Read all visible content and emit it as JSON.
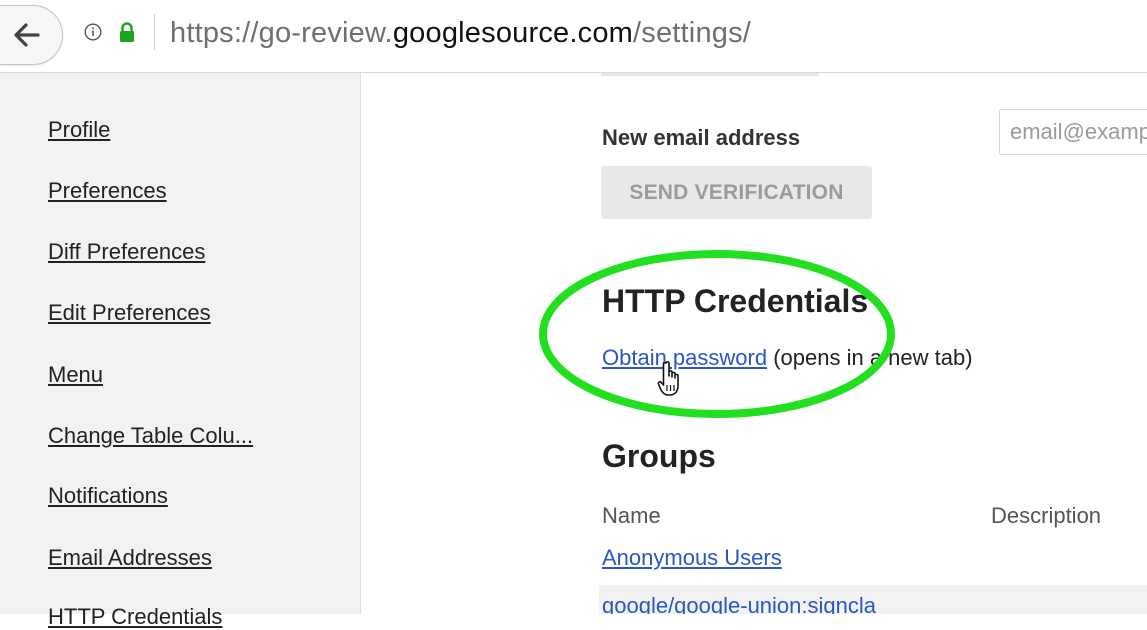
{
  "browser": {
    "url_prefix": "https://go-review.",
    "url_host": "googlesource.com",
    "url_suffix": "/settings/"
  },
  "sidebar": {
    "items": [
      {
        "label": "Profile"
      },
      {
        "label": "Preferences"
      },
      {
        "label": "Diff Preferences"
      },
      {
        "label": "Edit Preferences"
      },
      {
        "label": "Menu"
      },
      {
        "label": "Change Table Colu..."
      },
      {
        "label": "Notifications"
      },
      {
        "label": "Email Addresses"
      },
      {
        "label": "HTTP Credentials"
      }
    ]
  },
  "email": {
    "new_label": "New email address",
    "placeholder": "email@example.com",
    "send_button": "SEND VERIFICATION"
  },
  "http_credentials": {
    "heading": "HTTP Credentials",
    "link": "Obtain password",
    "note": " (opens in a new tab)"
  },
  "groups": {
    "heading": "Groups",
    "columns": [
      "Name",
      "Description"
    ],
    "rows": [
      {
        "name": "Anonymous Users"
      },
      {
        "name": "google/google-union:signcla"
      }
    ]
  },
  "colors": {
    "highlight": "#22e01f",
    "link": "#2a56c6",
    "sidebar_bg": "#f2f2f2"
  }
}
